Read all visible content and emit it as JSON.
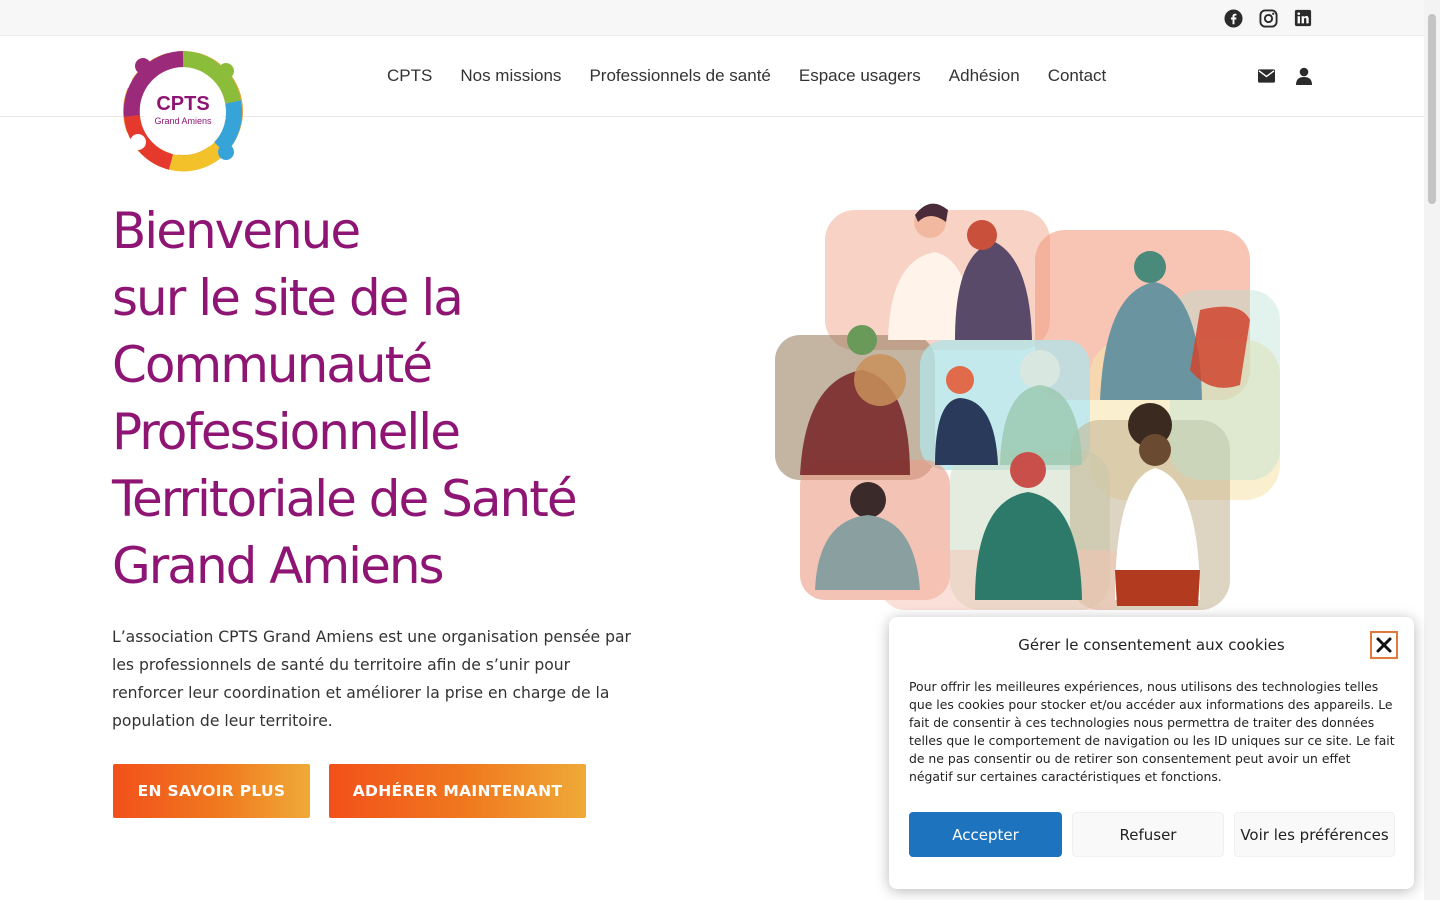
{
  "social": {
    "icons": [
      "facebook-icon",
      "instagram-icon",
      "linkedin-icon"
    ]
  },
  "logo": {
    "title": "CPTS",
    "subtitle": "Grand Amiens"
  },
  "nav": {
    "items": [
      "CPTS",
      "Nos missions",
      "Professionnels de santé",
      "Espace usagers",
      "Adhésion",
      "Contact"
    ]
  },
  "header_icons": [
    "envelope-icon",
    "user-icon"
  ],
  "hero": {
    "title_lines": [
      "Bienvenue",
      "sur le site de la",
      "Communauté",
      "Professionnelle",
      "Territoriale de Santé",
      "Grand Amiens"
    ],
    "description": "L’association CPTS Grand Amiens est une organisation pensée par les professionnels de santé du territoire afin de s’unir pour renforcer leur coordination et améliorer la prise en charge de la population de leur territoire.",
    "button_primary": "EN SAVOIR PLUS",
    "button_secondary": "ADHÉRER MAINTENANT"
  },
  "cookie": {
    "title": "Gérer le consentement aux cookies",
    "text": "Pour offrir les meilleures expériences, nous utilisons des technologies telles que les cookies pour stocker et/ou accéder aux informations des appareils. Le fait de consentir à ces technologies nous permettra de traiter des données telles que le comportement de navigation ou les ID uniques sur ce site. Le fait de ne pas consentir ou de retirer son consentement peut avoir un effet négatif sur certaines caractéristiques et fonctions.",
    "accept": "Accepter",
    "refuse": "Refuser",
    "preferences": "Voir les préférences"
  },
  "colors": {
    "brand_purple": "#8e1574",
    "button_orange_start": "#f2501a",
    "button_orange_end": "#efaa38",
    "accept_blue": "#1e73be"
  }
}
